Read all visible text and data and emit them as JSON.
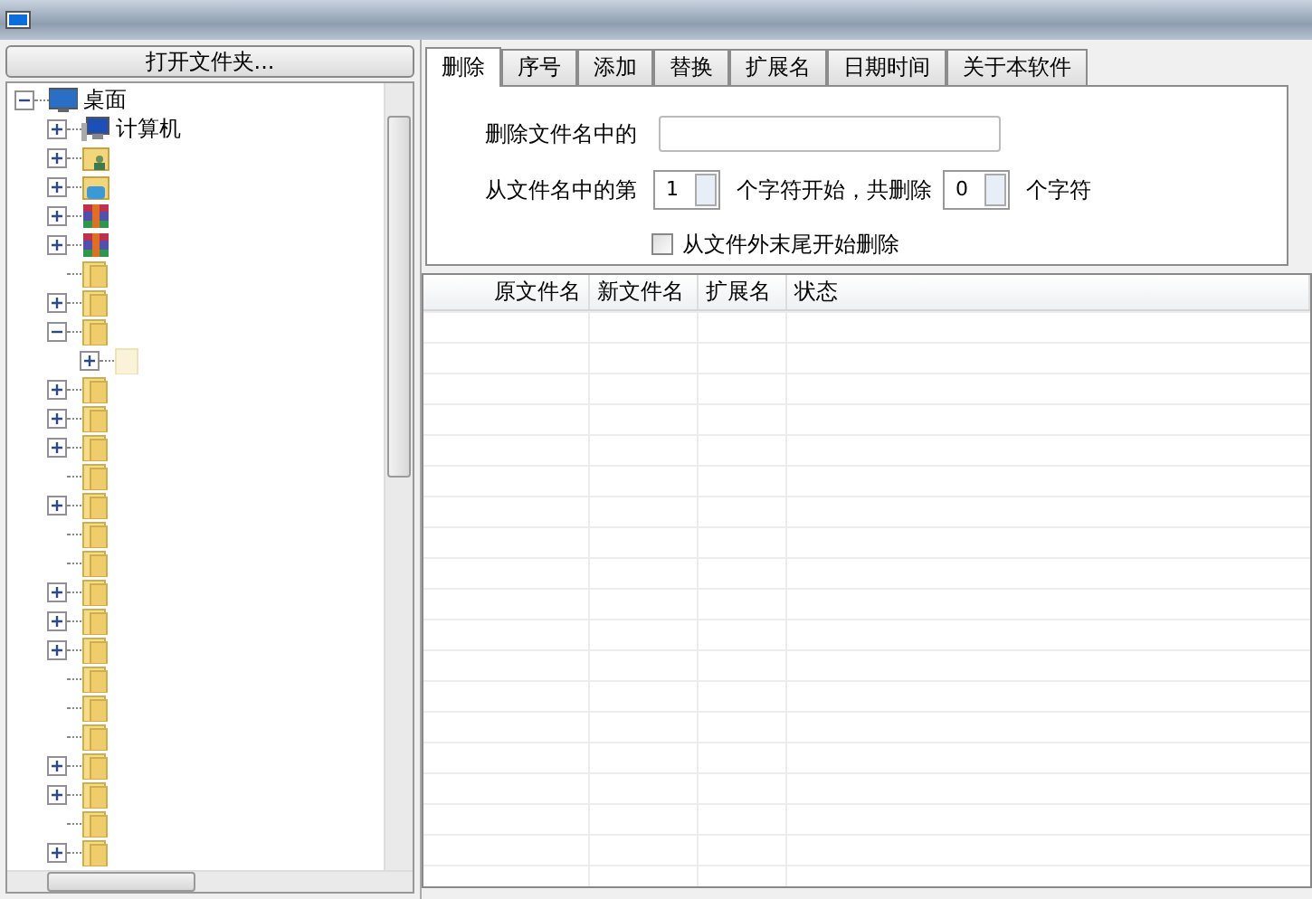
{
  "open_folder_button": "打开文件夹...",
  "tree": {
    "label": "桌面",
    "expanded": true,
    "children": [
      {
        "kind": "computer",
        "label": "计算机",
        "expanded": false
      },
      {
        "kind": "user-folder",
        "expanded": false
      },
      {
        "kind": "library",
        "expanded": false
      },
      {
        "kind": "archive",
        "expanded": false
      },
      {
        "kind": "archive",
        "expanded": false
      },
      {
        "kind": "folder"
      },
      {
        "kind": "folder",
        "expanded": false
      },
      {
        "kind": "folder",
        "expanded": true,
        "children": [
          {
            "kind": "faded-folder",
            "expanded": false
          }
        ]
      },
      {
        "kind": "folder",
        "expanded": false
      },
      {
        "kind": "folder",
        "expanded": false
      },
      {
        "kind": "folder",
        "expanded": false
      },
      {
        "kind": "folder"
      },
      {
        "kind": "folder",
        "expanded": false
      },
      {
        "kind": "folder"
      },
      {
        "kind": "folder"
      },
      {
        "kind": "folder",
        "expanded": false
      },
      {
        "kind": "folder",
        "expanded": false
      },
      {
        "kind": "folder",
        "expanded": false
      },
      {
        "kind": "folder"
      },
      {
        "kind": "folder"
      },
      {
        "kind": "folder"
      },
      {
        "kind": "folder",
        "expanded": false
      },
      {
        "kind": "folder",
        "expanded": false
      },
      {
        "kind": "folder"
      },
      {
        "kind": "folder",
        "expanded": false
      }
    ]
  },
  "tabs": [
    {
      "label": "删除",
      "selected": true
    },
    {
      "label": "序号",
      "selected": false
    },
    {
      "label": "添加",
      "selected": false
    },
    {
      "label": "替换",
      "selected": false
    },
    {
      "label": "扩展名",
      "selected": false
    },
    {
      "label": "日期时间",
      "selected": false
    },
    {
      "label": "关于本软件",
      "selected": false
    }
  ],
  "delete_panel": {
    "text_label": "删除文件名中的",
    "from_label": "从文件名中的第",
    "start_value": "1",
    "middle_label": "个字符开始，共删除",
    "count_value": "0",
    "end_label": "个字符",
    "from_end": {
      "label": "从文件外末尾开始删除",
      "checked": false
    }
  },
  "table": {
    "columns": [
      "原文件名",
      "新文件名",
      "扩展名",
      "状态"
    ]
  }
}
